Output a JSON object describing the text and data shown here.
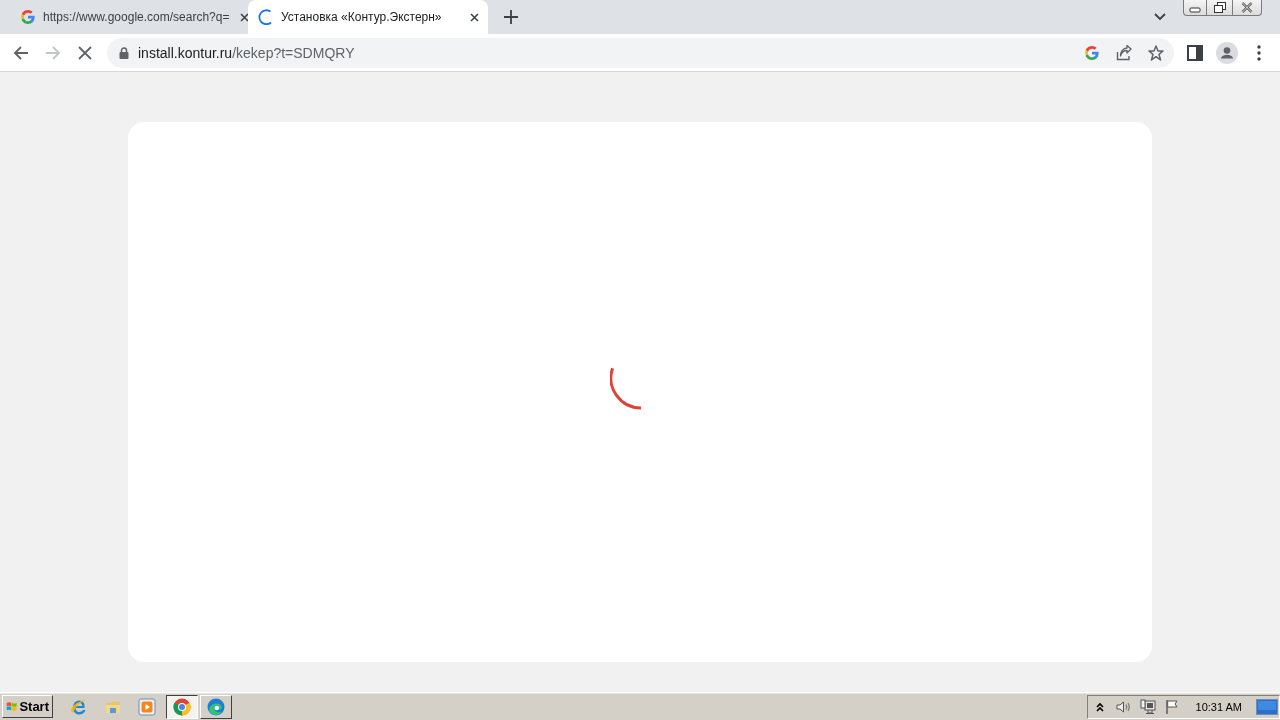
{
  "browser": {
    "loading": true,
    "tabs": [
      {
        "title": "https://www.google.com/search?q=",
        "selected": false,
        "loading": false
      },
      {
        "title": "Установка «Контур.Экстерн»",
        "selected": true,
        "loading": true
      }
    ],
    "nav": {
      "back_disabled": false,
      "forward_disabled": true
    },
    "address": {
      "host": "install.kontur.ru",
      "path": "/kekep?t=SDMQRY"
    }
  },
  "page": {
    "loading": true
  },
  "taskbar": {
    "start": "Start",
    "tasks": [
      {
        "selected": true
      },
      {
        "selected": false
      }
    ],
    "clock": "10:31 AM"
  }
}
